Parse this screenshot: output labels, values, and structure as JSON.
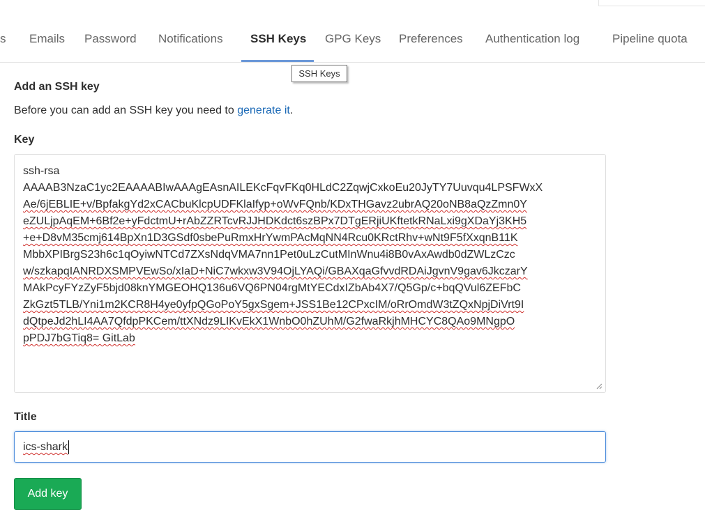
{
  "tabs": [
    {
      "label": "s"
    },
    {
      "label": "Emails"
    },
    {
      "label": "Password"
    },
    {
      "label": "Notifications"
    },
    {
      "label": "SSH Keys",
      "active": true
    },
    {
      "label": "GPG Keys"
    },
    {
      "label": "Preferences"
    },
    {
      "label": "Authentication log"
    },
    {
      "label": "Pipeline quota"
    }
  ],
  "tooltip": "SSH Keys",
  "form": {
    "section_title": "Add an SSH key",
    "help_prefix": "Before you can add an SSH key you need to ",
    "help_link": "generate it",
    "help_suffix": ".",
    "key_label": "Key",
    "key_lines": [
      "ssh-rsa",
      "AAAAB3NzaC1yc2EAAAABIwAAAgEAsnAILEKcFqvFKq0HLdC2ZqwjCxkoEu20JyTY7Uuvqu4LPSFWxX",
      "Ae/6jEBLIE+v/BpfakgYd2xCACbuKlcpUDFKlaIfyp+oWvFQnb/KDxTHGavz2ubrAQ20oNB8aQzZmn0Y",
      "eZULjpAqEM+6Bf2e+yFdctmU+rAbZZRTcvRJJHDKdct6szBPx7DTgERjiUKftetkRNaLxi9gXDaYj3KH5",
      "+e+D8vM35cmj614BpXn1D3GSdf0sbePuRmxHrYwmPAcMqNN4Rcu0KRctRhv+wNt9F5fXxqnB11K",
      "MbbXPIBrgS23h6c1qOyiwNTCd7ZXsNdqVMA7nn1Pet0uLzCutMInWnu4i8B0vAxAwdb0dZWLzCzc",
      "w/szkapqIANRDXSMPVEwSo/xIaD+NiC7wkxw3V94OjLYAQi/GBAXqaGfvvdRDAiJgvnV9gav6JkczarY",
      "MAkPcyFYzZyF5bjd08knYMGEOHQ136u6VQ6PN04rgMtYECdxIZbAb4X7/Q5Gp/c+bqQVul6ZEFbC",
      "ZkGzt5TLB/Yni1m2KCR8H4ye0yfpQGoPoY5gxSgem+JSS1Be12CPxcIM/oRrOmdW3tZQxNpjDiVrt9I",
      "dQtpeJd2hLI4AA7QfdpPKCem/ttXNdz9LIKvEkX1WnbO0hZUhM/G2fwaRkjhMHCYC8QAo9MNgpO",
      "pPDJ7bGTiq8= GitLab"
    ],
    "title_label": "Title",
    "title_value": "ics-shark",
    "submit_label": "Add key"
  }
}
